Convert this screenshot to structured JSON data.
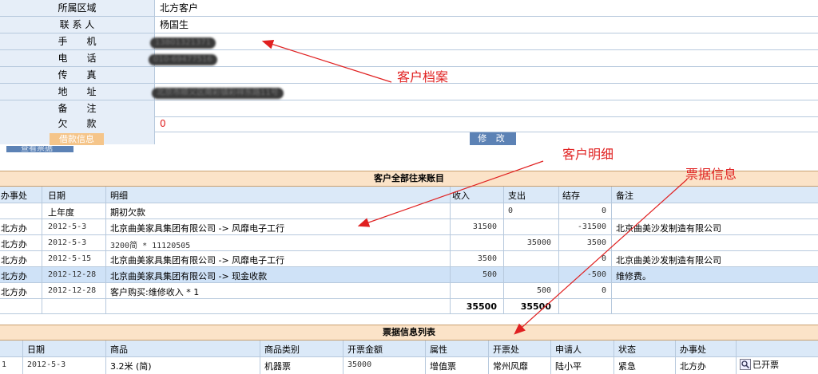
{
  "profile": {
    "rows": [
      {
        "label": "所属区域",
        "value": "北方客户",
        "blurred": false
      },
      {
        "label": "联 系 人",
        "value": "杨国生",
        "blurred": false
      },
      {
        "label": "手　　机",
        "value": "13801321371",
        "blurred": true
      },
      {
        "label": "电　　话",
        "value": "010-69477516",
        "blurred": true
      },
      {
        "label": "传　　真",
        "value": "",
        "blurred": false
      },
      {
        "label": "地　　址",
        "value": "北京市顺义区南彩镇彩祥东路11号",
        "blurred": true
      },
      {
        "label": "备　　注",
        "value": "",
        "blurred": false
      },
      {
        "label": "欠　　款",
        "value": "0",
        "blurred": false
      }
    ],
    "debt_button": "借款信息",
    "edit_button": "修 改",
    "view_button": "查看票据"
  },
  "ledger": {
    "title": "客户全部往来账目",
    "headers": [
      "办事处",
      "日期",
      "明细",
      "收入",
      "支出",
      "结存",
      "备注"
    ],
    "rows": [
      {
        "office": "",
        "date": "上年度",
        "detail": "期初欠款",
        "income": "",
        "expense": "0",
        "balance": "0",
        "note": ""
      },
      {
        "office": "北方办",
        "date": "2012-5-3",
        "detail": "北京曲美家具集团有限公司 -> 风靡电子工行",
        "income": "31500",
        "expense": "",
        "balance": "-31500",
        "note": "北京曲美沙发制造有限公司"
      },
      {
        "office": "北方办",
        "date": "2012-5-3",
        "detail": "3200简 * 11120505",
        "income": "",
        "expense": "35000",
        "balance": "3500",
        "note": ""
      },
      {
        "office": "北方办",
        "date": "2012-5-15",
        "detail": "北京曲美家具集团有限公司 -> 风靡电子工行",
        "income": "3500",
        "expense": "",
        "balance": "0",
        "note": "北京曲美沙发制造有限公司"
      },
      {
        "office": "北方办",
        "date": "2012-12-28",
        "detail": "北京曲美家具集团有限公司 -> 现金收款",
        "income": "500",
        "expense": "",
        "balance": "-500",
        "note": "维修费。"
      },
      {
        "office": "北方办",
        "date": "2012-12-28",
        "detail": "客户购买:维修收入 * 1",
        "income": "",
        "expense": "500",
        "balance": "0",
        "note": ""
      }
    ],
    "totals": {
      "income": "35500",
      "expense": "35500"
    }
  },
  "invoices": {
    "title": "票据信息列表",
    "headers": [
      "日期",
      "商品",
      "商品类别",
      "开票金额",
      "属性",
      "开票处",
      "申请人",
      "状态",
      "办事处"
    ],
    "rows": [
      {
        "index": "1",
        "date": "2012-5-3",
        "product": "3.2米 (简)",
        "category": "机器票",
        "amount": "35000",
        "attr": "增值票",
        "issuer": "常州风靡",
        "applicant": "陆小平",
        "status": "紧急",
        "office": "北方办",
        "action": "已开票"
      }
    ]
  },
  "annotations": {
    "profile": "客户档案",
    "detail": "客户明细",
    "invoice": "票据信息"
  },
  "colors": {
    "annotation": "#e02020",
    "header_bg": "#dbe9f8",
    "title_bg": "#fbe3c8",
    "highlight_row": "#cfe2f7"
  }
}
